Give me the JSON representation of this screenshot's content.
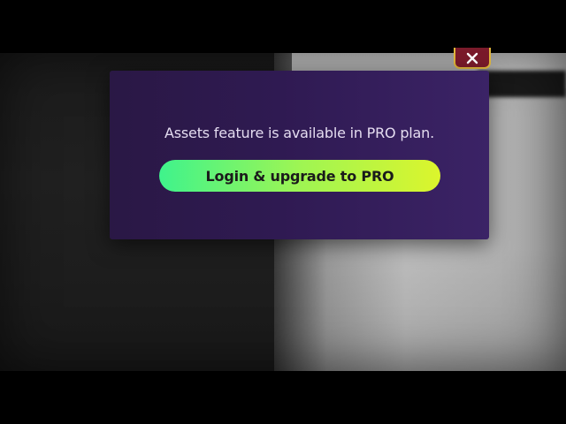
{
  "dialog": {
    "message": "Assets feature is available in PRO plan.",
    "button_label": "Login & upgrade to PRO",
    "close_icon": "close-icon"
  },
  "colors": {
    "dialog_bg_start": "#2a1845",
    "dialog_bg_end": "#3b2366",
    "button_gradient_start": "#3ff38c",
    "button_gradient_end": "#dcf52c",
    "close_bg": "#7a1a2a",
    "close_border": "#e0b63a"
  }
}
